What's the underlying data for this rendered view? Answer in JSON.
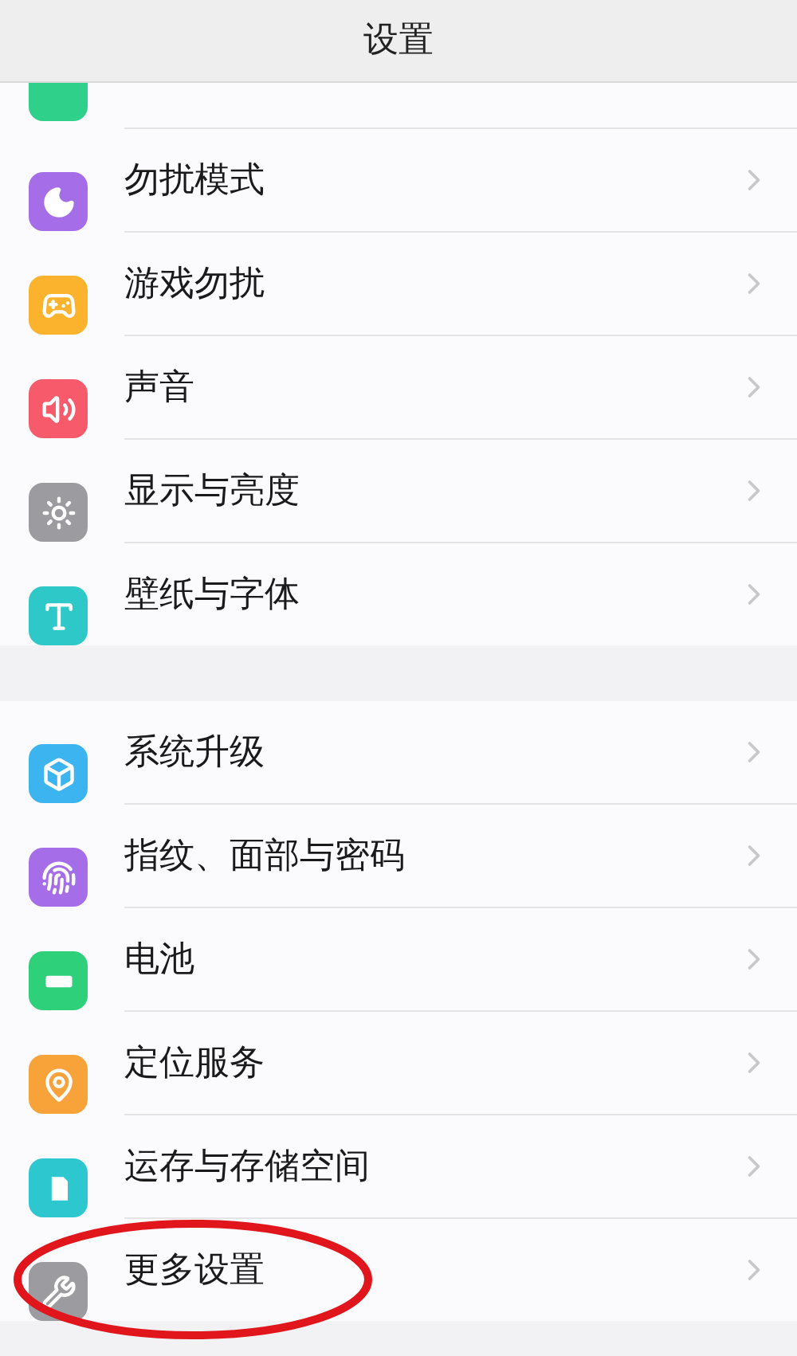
{
  "header": {
    "title": "设置"
  },
  "groups": [
    {
      "items": [
        {
          "color": "#2fd08a"
        },
        {
          "label": "勿扰模式",
          "color": "#a56ee8"
        },
        {
          "label": "游戏勿扰",
          "color": "#fbb32d"
        },
        {
          "label": "声音",
          "color": "#f65a6b"
        },
        {
          "label": "显示与亮度",
          "color": "#9c9ba0"
        },
        {
          "label": "壁纸与字体",
          "color": "#2fc8c8"
        }
      ]
    },
    {
      "items": [
        {
          "label": "系统升级",
          "color": "#3cb4f0"
        },
        {
          "label": "指纹、面部与密码",
          "color": "#a56ee8"
        },
        {
          "label": "电池",
          "color": "#2fd07a"
        },
        {
          "label": "定位服务",
          "color": "#f8a23a"
        },
        {
          "label": "运存与存储空间",
          "color": "#2cc7cf"
        },
        {
          "label": "更多设置",
          "color": "#9c9ba0"
        }
      ]
    }
  ]
}
